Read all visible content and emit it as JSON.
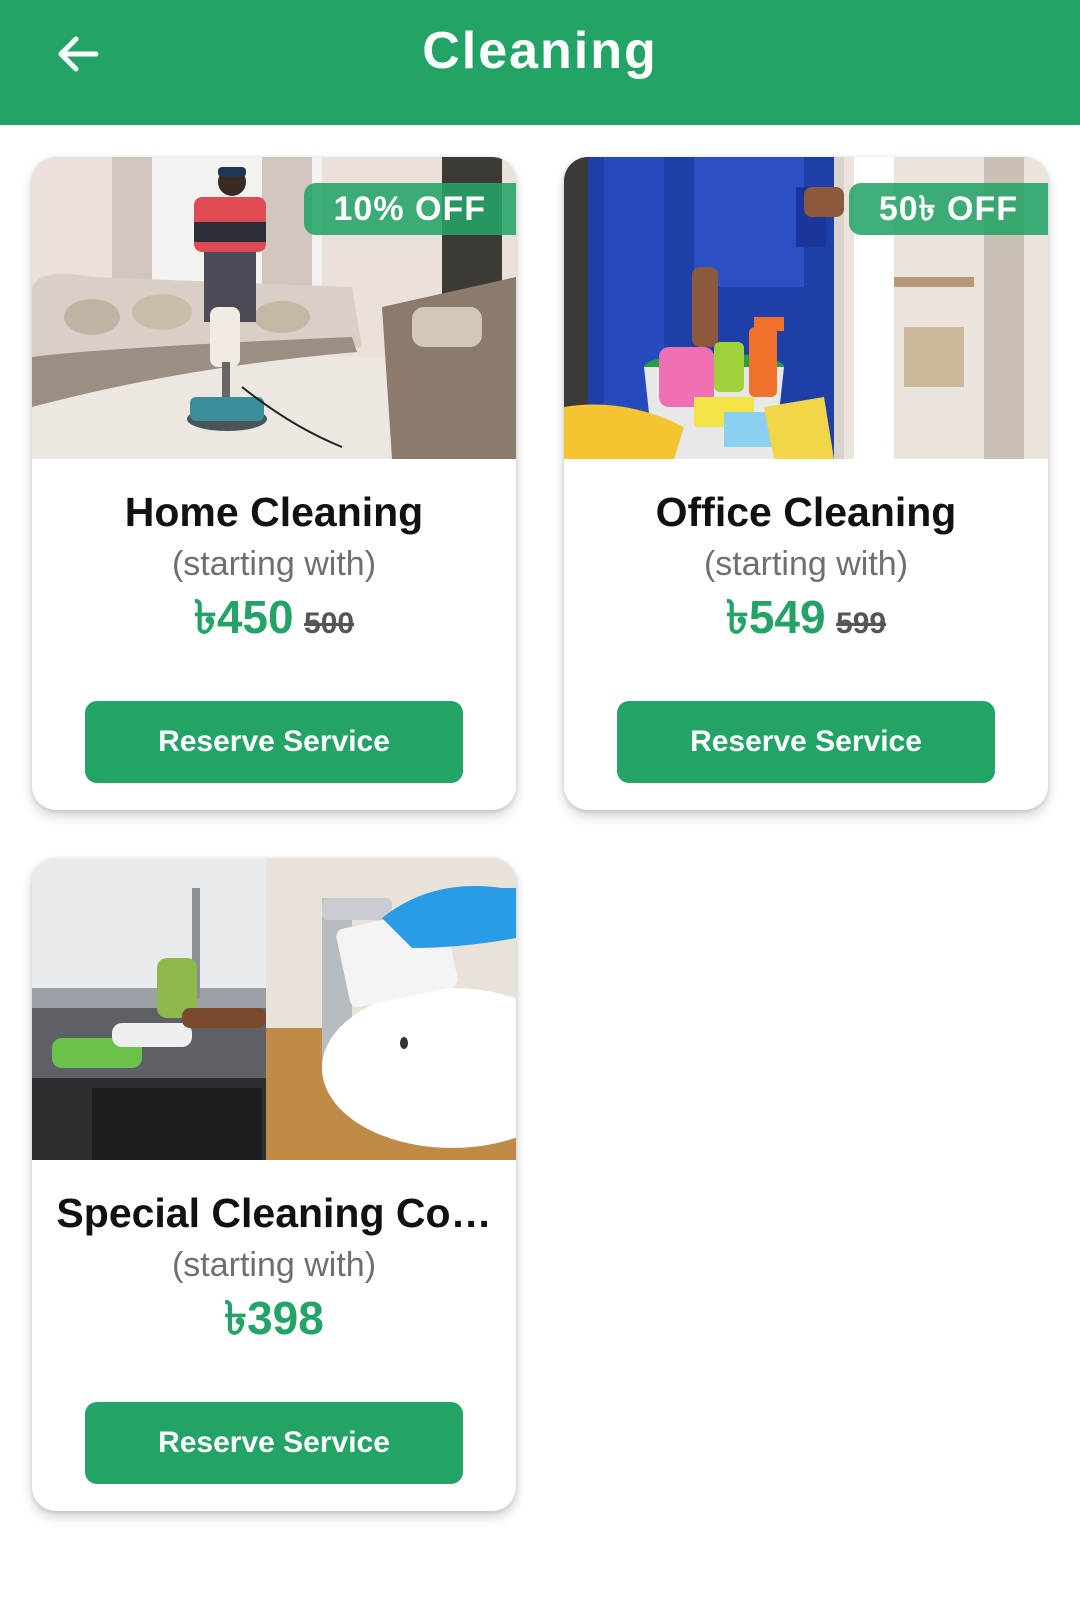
{
  "header": {
    "title": "Cleaning",
    "back_icon": "arrow-left-icon"
  },
  "colors": {
    "brand": "#24a367",
    "price": "#24a367",
    "subtext": "#6f6f6f"
  },
  "services": [
    {
      "title": "Home Cleaning",
      "subtitle": "(starting with)",
      "price": "৳450",
      "old_price": "500",
      "badge": "10% OFF",
      "button_label": "Reserve Service"
    },
    {
      "title": "Office Cleaning",
      "subtitle": "(starting with)",
      "price": "৳549",
      "old_price": "599",
      "badge": "50৳ OFF",
      "button_label": "Reserve Service"
    },
    {
      "title": "Special Cleaning Co…",
      "subtitle": "(starting with)",
      "price": "৳398",
      "button_label": "Reserve Service"
    }
  ]
}
